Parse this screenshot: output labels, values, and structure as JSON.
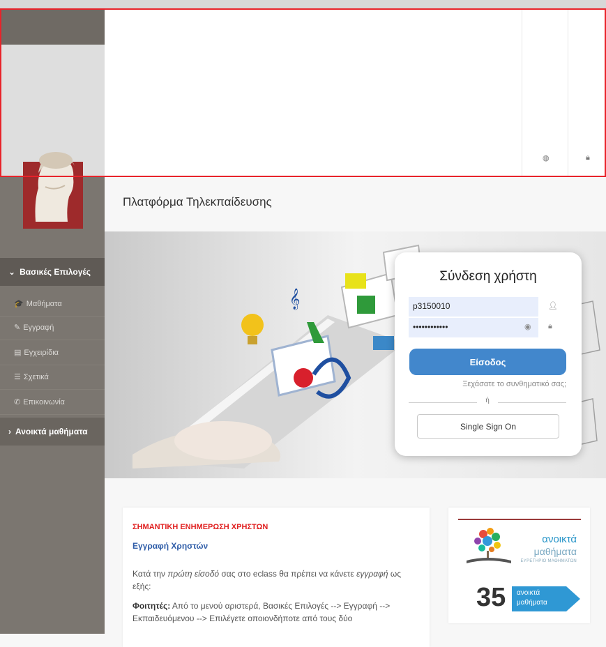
{
  "page": {
    "title": "Πλατφόρμα Τηλεκπαίδευσης"
  },
  "sidebar": {
    "main_menu_label": "Βασικές Επιλογές",
    "items": [
      {
        "label": "Μαθήματα",
        "icon": "graduation-cap-icon",
        "glyph": "🎓"
      },
      {
        "label": "Εγγραφή",
        "icon": "edit-icon",
        "glyph": "✎"
      },
      {
        "label": "Εγχειρίδια",
        "icon": "document-icon",
        "glyph": "▤"
      },
      {
        "label": "Σχετικά",
        "icon": "list-icon",
        "glyph": "☰"
      },
      {
        "label": "Επικοινωνία",
        "icon": "phone-icon",
        "glyph": "✆"
      }
    ],
    "open_courses_label": "Ανοικτά μαθήματα"
  },
  "header": {
    "icons": [
      "globe-icon",
      "lock-icon"
    ]
  },
  "login": {
    "title": "Σύνδεση χρήστη",
    "username_value": "p3150010",
    "password_value": "••••••••••••",
    "submit_label": "Είσοδος",
    "forgot_label": "Ξεχάσατε το συνθηματικό σας;",
    "or_label": "ή",
    "sso_label": "Single Sign On"
  },
  "news": {
    "title": "ΣΗΜΑΝΤΙΚΗ ΕΝΗΜΕΡΩΣΗ ΧΡΗΣΤΩΝ",
    "subtitle": "Εγγραφή Χρηστών",
    "p1_start": "Κατά την ",
    "p1_em1": "πρώτη είσοδό",
    "p1_mid": " σας στο eclass θα πρέπει να κάνετε ",
    "p1_em2": "εγγραφή",
    "p1_end": " ως εξής:",
    "p2_label": "Φοιτητές:",
    "p2_text": " Από το μενού αριστερά, Βασικές Επιλογές --> Εγγραφή --> Εκπαιδευόμενου --> Επιλέγετε οποιονδήποτε από τους δύο"
  },
  "open_courses": {
    "name_line1": "ανοικτά",
    "name_line2": "μαθήματα",
    "subtitle": "ΕΥΡΕΤΗΡΙΟ ΜΑΘΗΜΑΤΩΝ",
    "count": "35",
    "count_label_1": "ανοικτά",
    "count_label_2": "μαθήματα"
  },
  "colors": {
    "sidebar": "#7b7670",
    "primary_button": "#4287cc",
    "alert_title": "#e02020",
    "link_blue": "#2f5da8",
    "open_courses_blue": "#2a96c9"
  }
}
